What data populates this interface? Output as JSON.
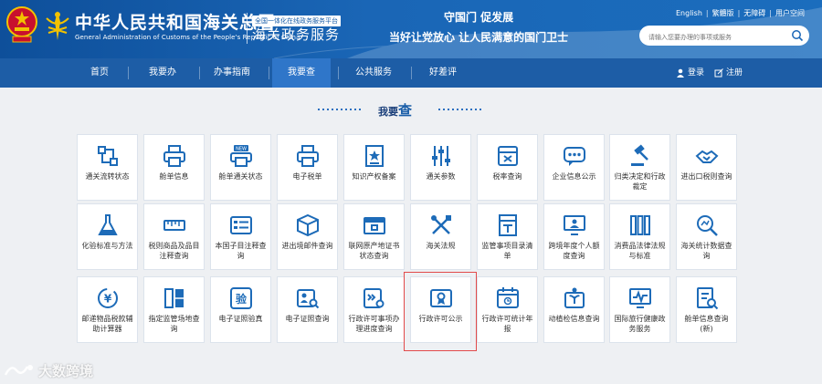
{
  "header": {
    "title_cn": "中华人民共和国海关总署",
    "title_en": "General Administration of Customs of the People's Republic of China",
    "platform_tag": "全国一体化在线政务服务平台",
    "service_title": "海关政务服务",
    "slogan_top": "守国门  促发展",
    "slogan_bottom": "当好让党放心  让人民满意的国门卫士",
    "top_links": [
      "English",
      "繁體版",
      "无障碍",
      "用户空间"
    ],
    "search_placeholder": "请输入您要办理的事项或服务"
  },
  "nav": {
    "items": [
      "首页",
      "我要办",
      "办事指南",
      "我要查",
      "公共服务",
      "好差评"
    ],
    "active_index": 3,
    "login": "登录",
    "register": "注册"
  },
  "section": {
    "title_prefix": "我要",
    "title_emph": "查"
  },
  "tiles": [
    {
      "label": "通关流转状态",
      "icon": "flow-icon"
    },
    {
      "label": "舱单信息",
      "icon": "printer-icon"
    },
    {
      "label": "舱单通关状态",
      "icon": "new-badge-printer-icon"
    },
    {
      "label": "电子税单",
      "icon": "printer-icon"
    },
    {
      "label": "知识产权备案",
      "icon": "certificate-star-icon"
    },
    {
      "label": "通关参数",
      "icon": "sliders-icon"
    },
    {
      "label": "税率查询",
      "icon": "tax-doc-icon"
    },
    {
      "label": "企业信息公示",
      "icon": "chat-dots-icon"
    },
    {
      "label": "归类决定和行政裁定",
      "icon": "gavel-icon"
    },
    {
      "label": "进出口税则查询",
      "icon": "handshake-icon"
    },
    {
      "label": "化验标准与方法",
      "icon": "flask-icon"
    },
    {
      "label": "税则商品及品目注释查询",
      "icon": "ruler-icon"
    },
    {
      "label": "本国子目注释查询",
      "icon": "list-card-icon"
    },
    {
      "label": "进出境邮件查询",
      "icon": "package-icon"
    },
    {
      "label": "联网原产地证书状态查询",
      "icon": "box-doc-icon"
    },
    {
      "label": "海关法规",
      "icon": "tools-icon"
    },
    {
      "label": "监管事项目录清单",
      "icon": "book-icon"
    },
    {
      "label": "跨境年度个人额度查询",
      "icon": "screen-person-icon"
    },
    {
      "label": "消费品法律法规与标准",
      "icon": "bars-icon"
    },
    {
      "label": "海关统计数据查询",
      "icon": "magnify-chart-icon"
    },
    {
      "label": "邮递物品税款辅助计算器",
      "icon": "yen-cycle-icon"
    },
    {
      "label": "指定监管场地查询",
      "icon": "panels-icon"
    },
    {
      "label": "电子证照验真",
      "icon": "verify-icon"
    },
    {
      "label": "电子证照查询",
      "icon": "id-search-icon"
    },
    {
      "label": "行政许可事项办理进度查询",
      "icon": "progress-search-icon"
    },
    {
      "label": "行政许可公示",
      "icon": "license-icon"
    },
    {
      "label": "行政许可统计年报",
      "icon": "calendar-icon"
    },
    {
      "label": "动植检信息查询",
      "icon": "plant-inspect-icon"
    },
    {
      "label": "国际旅行健康政务服务",
      "icon": "health-monitor-icon"
    },
    {
      "label": "舱单信息查询(新)",
      "icon": "doc-search-icon"
    }
  ],
  "watermark": "大数跨境",
  "colors": {
    "header": "#1a66b6",
    "nav": "#1d5da6",
    "nav_active": "#2f76c9",
    "icon": "#1d6bb8",
    "highlight": "#e24a4a"
  }
}
